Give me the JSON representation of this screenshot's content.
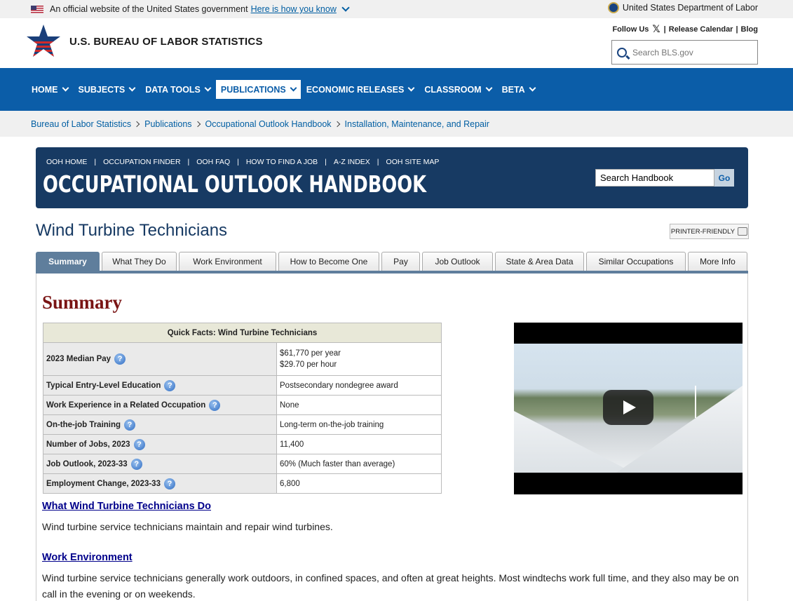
{
  "gov_banner": {
    "text": "An official website of the United States government",
    "link": "Here is how you know",
    "dept": "United States Department of Labor"
  },
  "header": {
    "logo_text": "U.S. BUREAU OF LABOR STATISTICS",
    "follow_us": "Follow Us",
    "x_icon": "𝕏",
    "release_calendar": "Release Calendar",
    "blog": "Blog",
    "search_placeholder": "Search BLS.gov"
  },
  "nav": {
    "items": [
      "HOME",
      "SUBJECTS",
      "DATA TOOLS",
      "PUBLICATIONS",
      "ECONOMIC RELEASES",
      "CLASSROOM",
      "BETA"
    ]
  },
  "breadcrumb": [
    "Bureau of Labor Statistics",
    "Publications",
    "Occupational Outlook Handbook",
    "Installation, Maintenance, and Repair"
  ],
  "ooh": {
    "links": [
      "OOH HOME",
      "OCCUPATION FINDER",
      "OOH FAQ",
      "HOW TO FIND A JOB",
      "A-Z INDEX",
      "OOH SITE MAP"
    ],
    "title": "OCCUPATIONAL OUTLOOK HANDBOOK",
    "search_value": "Search Handbook",
    "go_label": "Go"
  },
  "page": {
    "title": "Wind Turbine Technicians",
    "printer_label": "PRINTER-FRIENDLY"
  },
  "tabs": [
    "Summary",
    "What They Do",
    "Work Environment",
    "How to Become One",
    "Pay",
    "Job Outlook",
    "State & Area Data",
    "Similar Occupations",
    "More Info"
  ],
  "summary": {
    "heading": "Summary",
    "table_title": "Quick Facts: Wind Turbine Technicians",
    "rows": [
      {
        "label": "2023 Median Pay",
        "value": "$61,770 per year",
        "value2": "$29.70 per hour"
      },
      {
        "label": "Typical Entry-Level Education",
        "value": "Postsecondary nondegree award"
      },
      {
        "label": "Work Experience in a Related Occupation",
        "value": "None"
      },
      {
        "label": "On-the-job Training",
        "value": "Long-term on-the-job training"
      },
      {
        "label": "Number of Jobs, 2023",
        "value": "11,400"
      },
      {
        "label": "Job Outlook, 2023-33",
        "value": "60% (Much faster than average)"
      },
      {
        "label": "Employment Change, 2023-33",
        "value": "6,800"
      }
    ],
    "help_glyph": "?",
    "sections": [
      {
        "title": "What Wind Turbine Technicians Do",
        "text": "Wind turbine service technicians maintain and repair wind turbines."
      },
      {
        "title": "Work Environment",
        "text": "Wind turbine service technicians generally work outdoors, in confined spaces, and often at great heights. Most windtechs work full time, and they also may be on call in the evening or on weekends."
      }
    ]
  }
}
